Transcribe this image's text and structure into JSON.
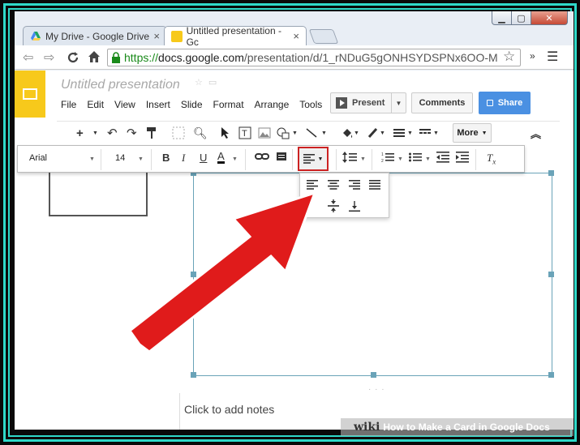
{
  "browser": {
    "tabs": [
      {
        "label": "My Drive - Google Drive",
        "close": "×"
      },
      {
        "label": "Untitled presentation - Gc",
        "close": "×"
      }
    ],
    "url": {
      "scheme": "https://",
      "host": "docs.google.com",
      "path": "/presentation/d/1_rNDuG5gONHSYDSPNx6OO-M"
    },
    "window_controls": {
      "minimize": "▁",
      "maximize": "▢",
      "close": "✕"
    },
    "colors": {
      "https_green": "#1a8a1a",
      "frame_teal": "#2fd9c9"
    }
  },
  "docs": {
    "title": "Untitled presentation",
    "menu": [
      "File",
      "Edit",
      "View",
      "Insert",
      "Slide",
      "Format",
      "Arrange",
      "Tools"
    ],
    "present_label": "Present",
    "comments_label": "Comments",
    "share_label": "Share",
    "more_label": "More",
    "font": "Arial",
    "font_size": "14",
    "notes_placeholder": "Click to add notes",
    "colors": {
      "logo": "#f7c91b",
      "share": "#4a90e2",
      "highlight": "#cc2222",
      "selection": "#6aa3b8"
    }
  },
  "watermark": {
    "brand": "wiki",
    "text": "How to Make a Card in Google Docs"
  }
}
